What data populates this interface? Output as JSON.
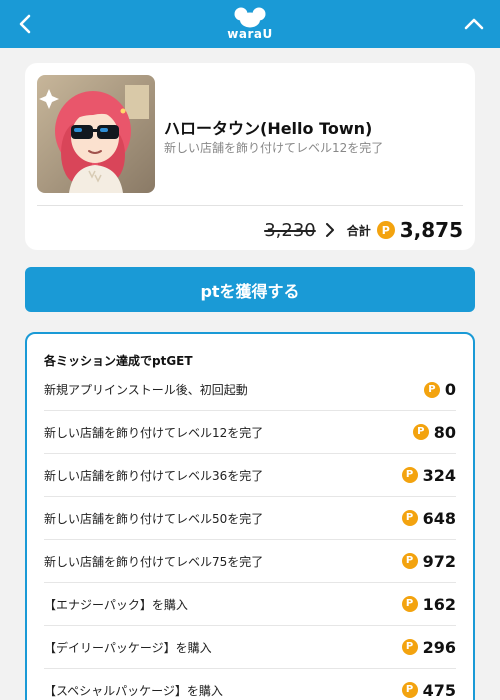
{
  "header": {
    "logo_text": "waraU",
    "back_icon": "chevron-left-icon",
    "collapse_icon": "chevron-up-icon"
  },
  "app": {
    "title": "ハロータウン(Hello Town)",
    "subtitle": "新しい店舗を飾り付けてレベル12を完了",
    "old_points": "3,230",
    "total_label": "合計",
    "total_points": "3,875"
  },
  "coin_symbol": "P",
  "get_button": {
    "label": "ptを獲得する"
  },
  "missions": {
    "heading": "各ミッション達成でptGET",
    "items": [
      {
        "label": "新規アプリインストール後、初回起動",
        "points": "0"
      },
      {
        "label": "新しい店舗を飾り付けてレベル12を完了",
        "points": "80"
      },
      {
        "label": "新しい店舗を飾り付けてレベル36を完了",
        "points": "324"
      },
      {
        "label": "新しい店舗を飾り付けてレベル50を完了",
        "points": "648"
      },
      {
        "label": "新しい店舗を飾り付けてレベル75を完了",
        "points": "972"
      },
      {
        "label": "【エナジーパック】を購入",
        "points": "162"
      },
      {
        "label": "【デイリーパッケージ】を購入",
        "points": "296"
      },
      {
        "label": "【スペシャルパッケージ】を購入",
        "points": "475"
      }
    ]
  },
  "colors": {
    "accent": "#1a9ad6",
    "coin": "#f3a30f",
    "background": "#f2f2f2"
  }
}
